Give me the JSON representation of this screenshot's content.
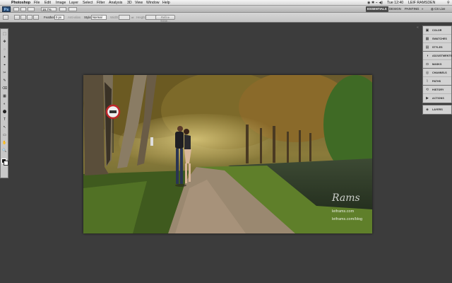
{
  "menubar": {
    "apple": "",
    "items": [
      "Photoshop",
      "File",
      "Edit",
      "Image",
      "Layer",
      "Select",
      "Filter",
      "Analysis",
      "3D",
      "View",
      "Window",
      "Help"
    ],
    "clock": "Tue 12:40",
    "user": "LEIF RAMSDEN"
  },
  "appbar": {
    "logo": "Ps",
    "zoom": "16.7%",
    "workspaces": [
      "ESSENTIALS",
      "DESIGN",
      "PAINTING"
    ],
    "more": "»",
    "cslive": "CS Live"
  },
  "options": {
    "feather_label": "Feather:",
    "feather_value": "0 px",
    "antialias_label": "Anti-alias",
    "style_label": "Style:",
    "style_value": "Normal",
    "width_label": "Width:",
    "height_label": "Height:",
    "refine_edge": "Refine Edge..."
  },
  "tools": [
    "⬚",
    "✥",
    "◌",
    "✦",
    "⌖",
    "✂",
    "✎",
    "⌫",
    "▦",
    "◐",
    "⬤",
    "T",
    "↖",
    "▭",
    "✋",
    "🔍"
  ],
  "panels": {
    "group1": [
      {
        "icon": "▣",
        "label": "COLOR"
      },
      {
        "icon": "▦",
        "label": "SWATCHES"
      },
      {
        "icon": "▤",
        "label": "STYLES"
      }
    ],
    "group2": [
      {
        "icon": "◑",
        "label": "ADJUSTMENTS"
      },
      {
        "icon": "◘",
        "label": "MASKS"
      }
    ],
    "group3": [
      {
        "icon": "◎",
        "label": "CHANNELS"
      },
      {
        "icon": "⌇",
        "label": "PATHS"
      }
    ],
    "group4": [
      {
        "icon": "⟲",
        "label": "HISTORY"
      },
      {
        "icon": "▶",
        "label": "ACTIONS"
      }
    ],
    "group5": [
      {
        "icon": "◈",
        "label": "LAYERS"
      }
    ]
  },
  "photo": {
    "watermark": "Rams",
    "site1": "leiframs.com",
    "site2": "leiframs.com/blog"
  }
}
